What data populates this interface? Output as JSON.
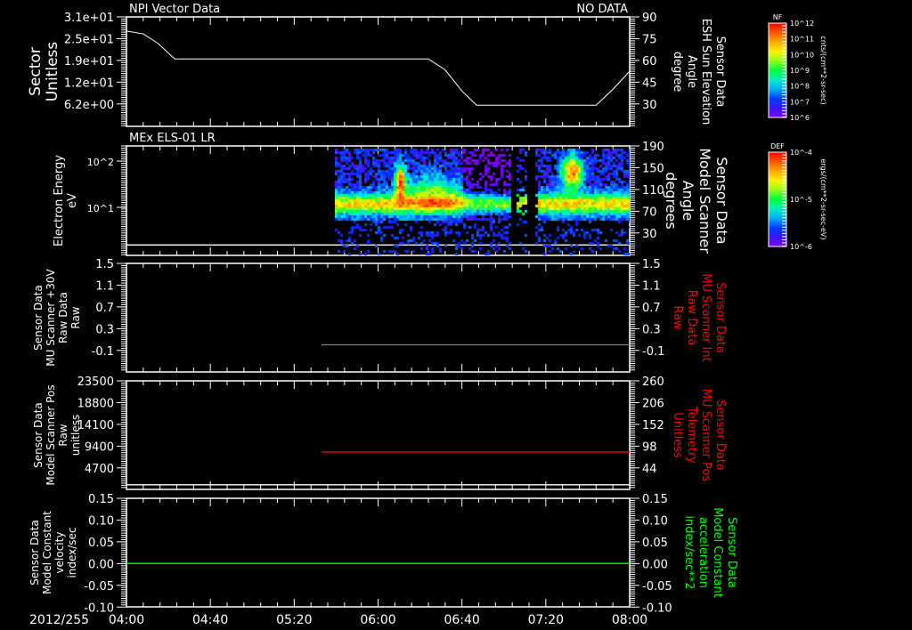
{
  "header": {
    "title": "NPI Vector Data",
    "status": "NO DATA",
    "date": "2012/255"
  },
  "time_axis": {
    "labels": [
      "04:00",
      "04:40",
      "05:20",
      "06:00",
      "06:40",
      "07:20",
      "08:00"
    ],
    "range_minutes": [
      0,
      240
    ]
  },
  "colorbars": [
    {
      "title": "NF",
      "units": "cnts/(cm**2-sr-sec)",
      "labels": [
        "10^12",
        "10^11",
        "10^10",
        "10^9",
        "10^8",
        "10^7",
        "10^6"
      ]
    },
    {
      "title": "DEF",
      "units": "ergs/(cm**2-sr-sec-eV)",
      "labels": [
        "10^-4",
        "10^-5",
        "10^-6"
      ]
    }
  ],
  "chart_data": [
    {
      "type": "line",
      "title": "NPI Vector Data",
      "left_label": [
        "Sector",
        "Unitless"
      ],
      "left_ticks": [
        "3.1e+01",
        "2.5e+01",
        "1.9e+01",
        "1.2e+01",
        "6.2e+00"
      ],
      "ylim": [
        0,
        31
      ],
      "right_label": [
        "Sensor Data",
        "ESH Sun Elevation",
        "Angle",
        "degree"
      ],
      "right_color": "#ffffff",
      "right_ticks": [
        "90",
        "75",
        "60",
        "45",
        "30"
      ],
      "ylim_right": [
        15,
        90
      ],
      "series": [
        {
          "name": "Sector",
          "color": "#ffffff",
          "x": [
            0,
            8,
            15,
            23,
            144,
            152,
            160,
            167,
            224,
            232,
            240
          ],
          "y": [
            27,
            26.2,
            23.5,
            19.1,
            19.1,
            16,
            10,
            6,
            6,
            10.5,
            15.6
          ]
        }
      ]
    },
    {
      "type": "heatmap",
      "title": "MEx ELS-01 LR",
      "left_label": [
        "Electron Energy",
        "eV"
      ],
      "left_ticks": [
        "10^2",
        "10^1"
      ],
      "ylim": [
        0.92,
        212
      ],
      "yscale": "log",
      "right_label": [
        "Sensor Data",
        "Model Scanner",
        "Angle",
        "degrees"
      ],
      "right_color": "#ffffff",
      "right_ticks": [
        "190",
        "150",
        "110",
        "70",
        "30"
      ],
      "ylim_right": [
        -10,
        190
      ],
      "data_start_minute": 99,
      "features": [
        {
          "minute": 130,
          "energy_eV": 40,
          "level": "max"
        },
        {
          "minute": 145,
          "energy_eV": 25,
          "level": "high"
        },
        {
          "minute": 212,
          "energy_eV": 60,
          "level": "max"
        }
      ],
      "series": [
        {
          "name": "Scanner Angle",
          "color": "#ffffff",
          "x": [
            0,
            240
          ],
          "y": [
            9,
            9
          ]
        }
      ]
    },
    {
      "type": "line",
      "title": "",
      "left_label": [
        "Sensor Data",
        "MU Scanner +30V",
        "Raw Data",
        "Raw"
      ],
      "left_ticks": [
        "1.5",
        "1.1",
        "0.7",
        "0.3",
        "-0.1"
      ],
      "ylim": [
        -0.5,
        1.5
      ],
      "right_label": [
        "Sensor Data",
        "MU Scanner Int",
        "Raw Data",
        "Raw"
      ],
      "right_color": "#ff0000",
      "right_ticks": [
        "1.5",
        "1.1",
        "0.7",
        "0.3",
        "-0.1"
      ],
      "ylim_right": [
        -0.5,
        1.5
      ],
      "series": [
        {
          "name": "MU Scanner Int",
          "color": "#808080",
          "x": [
            93,
            240
          ],
          "y": [
            0.0,
            0.0
          ]
        }
      ]
    },
    {
      "type": "line",
      "title": "",
      "left_label": [
        "Sensor Data",
        "Model Scanner Pos",
        "Raw",
        "unitless"
      ],
      "left_ticks": [
        "23500",
        "18800",
        "14100",
        "9400",
        "4700"
      ],
      "ylim": [
        0,
        23500
      ],
      "right_label": [
        "Sensor Data",
        "MU Scanner Pos",
        "Telemetry",
        "Unitless"
      ],
      "right_color": "#ff0000",
      "right_ticks": [
        "260",
        "206",
        "152",
        "98",
        "44"
      ],
      "ylim_right": [
        -10,
        260
      ],
      "series": [
        {
          "name": "Model Scanner Pos",
          "color": "#ffffff",
          "x": [
            0,
            240
          ],
          "y": [
            1000,
            1000
          ]
        },
        {
          "name": "MU Scanner Pos",
          "color": "#ff0000",
          "x": [
            93,
            240
          ],
          "y": [
            8100,
            8100
          ]
        }
      ]
    },
    {
      "type": "line",
      "title": "",
      "left_label": [
        "Sensor Data",
        "Model Constant",
        "velocity",
        "index/sec"
      ],
      "left_ticks": [
        "0.15",
        "0.10",
        "0.05",
        "0.00",
        "-0.05",
        "-0.10"
      ],
      "ylim": [
        -0.1,
        0.15
      ],
      "right_label": [
        "Sensor Data",
        "Model Constant",
        "acceleration",
        "index/sec**2"
      ],
      "right_color": "#00ff00",
      "right_ticks": [
        "0.15",
        "0.10",
        "0.05",
        "0.00",
        "-0.05",
        "-0.10"
      ],
      "ylim_right": [
        -0.1,
        0.15
      ],
      "series": [
        {
          "name": "velocity",
          "color": "#00ff00",
          "x": [
            0,
            240
          ],
          "y": [
            0,
            0
          ]
        }
      ]
    }
  ]
}
